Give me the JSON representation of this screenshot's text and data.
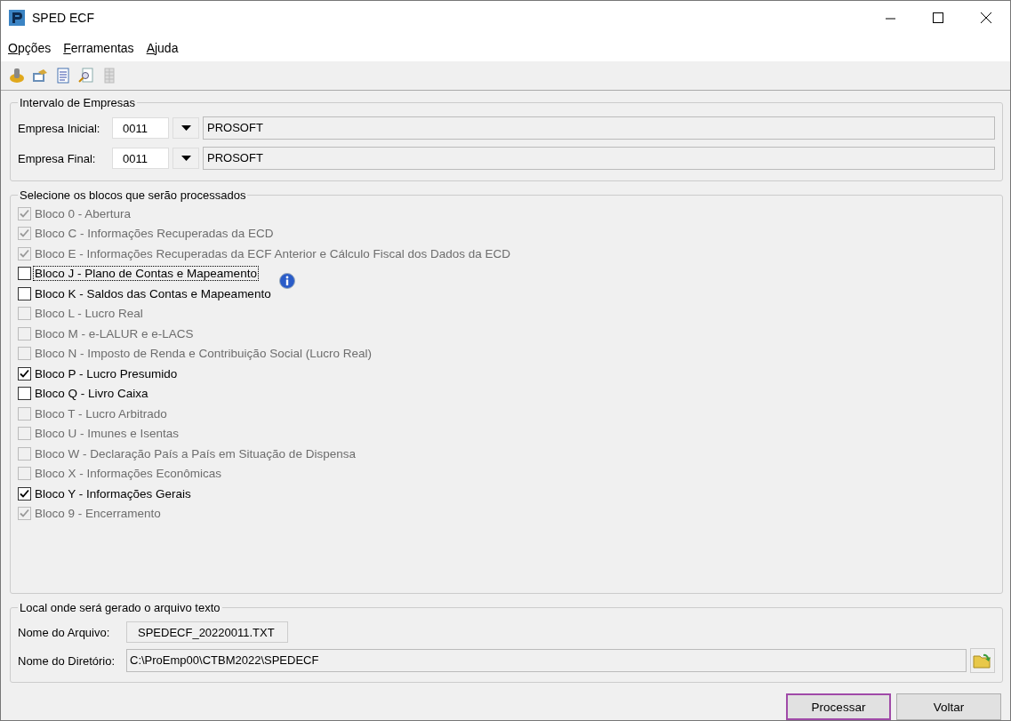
{
  "window": {
    "title": "SPED ECF"
  },
  "menu": [
    "Opções",
    "Ferramentas",
    "Ajuda"
  ],
  "companies": {
    "title": "Intervalo de Empresas",
    "rows": [
      {
        "label": "Empresa Inicial:",
        "code": "0011",
        "name": "PROSOFT"
      },
      {
        "label": "Empresa Final:",
        "code": "0011",
        "name": "PROSOFT"
      }
    ]
  },
  "blocks": {
    "title": "Selecione os blocos que serão processados",
    "items": [
      {
        "label": "Bloco 0 - Abertura",
        "checked": true,
        "disabled": true,
        "focused": false,
        "info": false
      },
      {
        "label": "Bloco C - Informações Recuperadas da ECD",
        "checked": true,
        "disabled": true,
        "focused": false,
        "info": false
      },
      {
        "label": "Bloco E - Informações Recuperadas da ECF Anterior e Cálculo Fiscal dos Dados da ECD",
        "checked": true,
        "disabled": true,
        "focused": false,
        "info": false
      },
      {
        "label": "Bloco J - Plano de Contas e Mapeamento",
        "checked": false,
        "disabled": false,
        "focused": true,
        "info": true
      },
      {
        "label": "Bloco K - Saldos das Contas e Mapeamento",
        "checked": false,
        "disabled": false,
        "focused": false,
        "info": false
      },
      {
        "label": "Bloco L - Lucro Real",
        "checked": false,
        "disabled": true,
        "focused": false,
        "info": false
      },
      {
        "label": "Bloco M - e-LALUR e e-LACS",
        "checked": false,
        "disabled": true,
        "focused": false,
        "info": false
      },
      {
        "label": "Bloco N - Imposto de Renda e Contribuição Social (Lucro Real)",
        "checked": false,
        "disabled": true,
        "focused": false,
        "info": false
      },
      {
        "label": "Bloco P - Lucro Presumido",
        "checked": true,
        "disabled": false,
        "focused": false,
        "info": false
      },
      {
        "label": "Bloco Q - Livro Caixa",
        "checked": false,
        "disabled": false,
        "focused": false,
        "info": false
      },
      {
        "label": "Bloco T - Lucro Arbitrado",
        "checked": false,
        "disabled": true,
        "focused": false,
        "info": false
      },
      {
        "label": "Bloco U - Imunes e Isentas",
        "checked": false,
        "disabled": true,
        "focused": false,
        "info": false
      },
      {
        "label": "Bloco W - Declaração País a País em Situação de Dispensa",
        "checked": false,
        "disabled": true,
        "focused": false,
        "info": false
      },
      {
        "label": "Bloco X - Informações Econômicas",
        "checked": false,
        "disabled": true,
        "focused": false,
        "info": false
      },
      {
        "label": "Bloco Y - Informações Gerais",
        "checked": true,
        "disabled": false,
        "focused": false,
        "info": false
      },
      {
        "label": "Bloco 9 - Encerramento",
        "checked": true,
        "disabled": true,
        "focused": false,
        "info": false
      }
    ]
  },
  "output": {
    "title": "Local onde será gerado o arquivo texto",
    "file_label": "Nome do Arquivo:",
    "file_name": "SPEDECF_20220011.TXT",
    "dir_label": "Nome do Diretório:",
    "dir_value": "C:\\ProEmp00\\CTBM2022\\SPEDECF"
  },
  "buttons": [
    {
      "label": "Processar",
      "highlighted": true
    },
    {
      "label": "Voltar",
      "highlighted": false
    }
  ]
}
